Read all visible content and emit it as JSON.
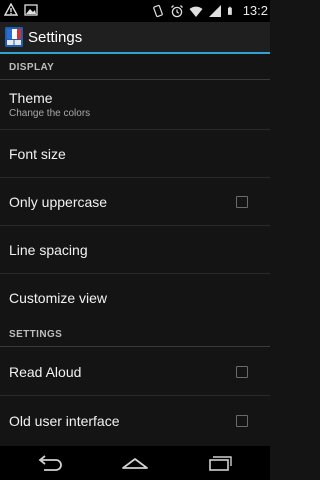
{
  "status_bar": {
    "time": "13:2",
    "icons": [
      "notification-warning-icon",
      "image-icon",
      "vibrate-icon",
      "alarm-icon",
      "wifi-icon",
      "signal-icon",
      "battery-icon"
    ]
  },
  "action_bar": {
    "title": "Settings",
    "icon": "app-flag-book-icon"
  },
  "sections": {
    "display": {
      "header": "DISPLAY",
      "theme_label": "Theme",
      "theme_sub": "Change the colors",
      "font_size_label": "Font size",
      "only_uppercase_label": "Only uppercase",
      "line_spacing_label": "Line spacing",
      "customize_view_label": "Customize view"
    },
    "settings": {
      "header": "SETTINGS",
      "read_aloud_label": "Read Aloud",
      "old_ui_label": "Old user interface"
    }
  },
  "checkboxes": {
    "only_uppercase": false,
    "read_aloud": false,
    "old_ui": false
  },
  "nav_bar": {
    "icons": [
      "back-icon",
      "home-icon",
      "recent-apps-icon"
    ]
  },
  "colors": {
    "accent": "#2ea3d6",
    "background": "#141414"
  }
}
